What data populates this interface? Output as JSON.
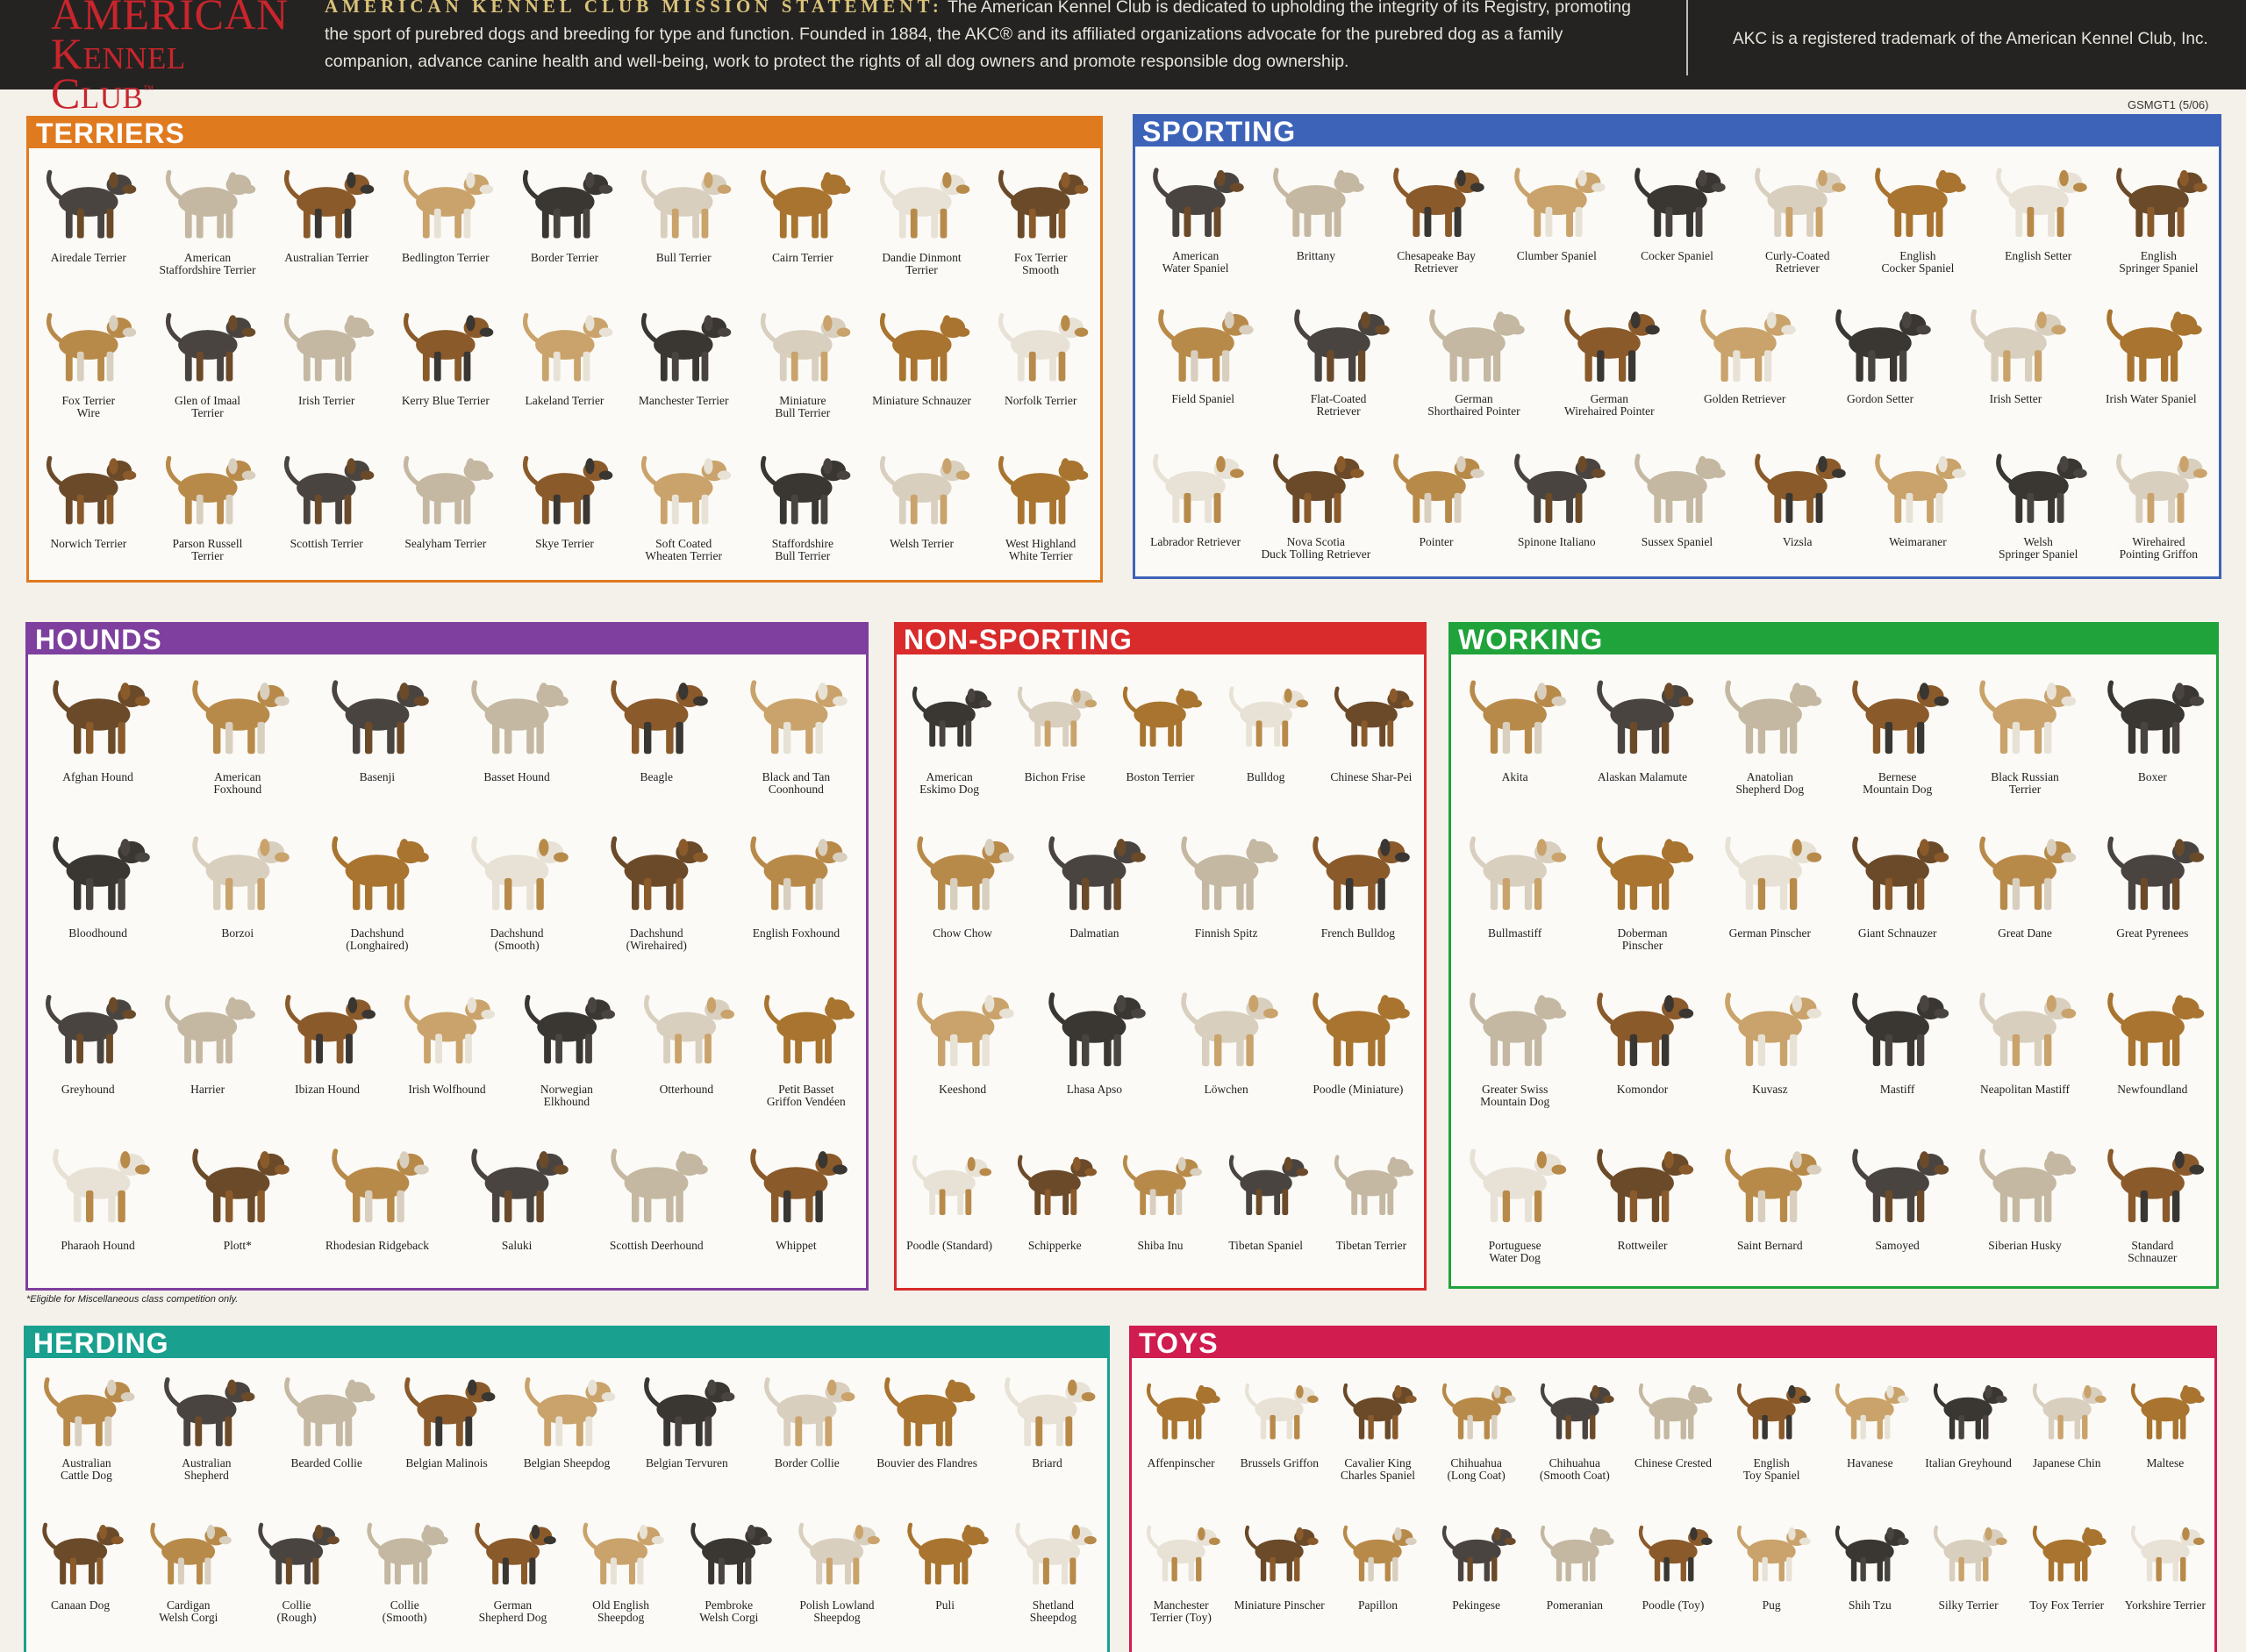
{
  "header": {
    "logo_line1": "American",
    "logo_line2": "Kennel Club",
    "logo_mark": "™",
    "mission_heading": "American Kennel Club Mission Statement:",
    "mission_text": "The American Kennel Club is dedicated to upholding the integrity of its Registry, promoting the sport of purebred dogs and breeding for type and function. Founded in 1884, the AKC® and its affiliated organizations advocate for the purebred dog as a family companion, advance canine health and well-being, work to protect the rights of all dog owners and promote responsible dog ownership.",
    "trademark_note": "AKC is a registered trademark of the American Kennel Club, Inc.",
    "code": "GSMGT1 (5/06)"
  },
  "colors": {
    "terriers": "#e07a1f",
    "sporting": "#3d63b8",
    "hounds": "#7e3f9e",
    "non_sporting": "#d92b2b",
    "working": "#1fa33a",
    "herding": "#1aa08e",
    "toys": "#d01c4f"
  },
  "groups": {
    "terriers": {
      "title": "TERRIERS",
      "breeds": [
        "Airedale Terrier",
        "American\nStaffordshire Terrier",
        "Australian Terrier",
        "Bedlington Terrier",
        "Border Terrier",
        "Bull Terrier",
        "Cairn Terrier",
        "Dandie Dinmont\nTerrier",
        "Fox Terrier\nSmooth",
        "Fox Terrier\nWire",
        "Glen of Imaal\nTerrier",
        "Irish Terrier",
        "Kerry Blue Terrier",
        "Lakeland Terrier",
        "Manchester Terrier",
        "Miniature\nBull Terrier",
        "Miniature Schnauzer",
        "Norfolk Terrier",
        "Norwich Terrier",
        "Parson Russell\nTerrier",
        "Scottish Terrier",
        "Sealyham Terrier",
        "Skye Terrier",
        "Soft Coated\nWheaten Terrier",
        "Staffordshire\nBull Terrier",
        "Welsh Terrier",
        "West Highland\nWhite Terrier"
      ]
    },
    "sporting": {
      "title": "SPORTING",
      "breeds": [
        "American\nWater Spaniel",
        "Brittany",
        "Chesapeake Bay\nRetriever",
        "Clumber Spaniel",
        "Cocker Spaniel",
        "Curly-Coated\nRetriever",
        "English\nCocker Spaniel",
        "English Setter",
        "English\nSpringer Spaniel",
        "Field Spaniel",
        "Flat-Coated\nRetriever",
        "German\nShorthaired Pointer",
        "German\nWirehaired Pointer",
        "Golden Retriever",
        "Gordon Setter",
        "Irish Setter",
        "Irish Water Spaniel",
        "Labrador Retriever",
        "Nova Scotia\nDuck Tolling Retriever",
        "Pointer",
        "Spinone Italiano",
        "Sussex Spaniel",
        "Vizsla",
        "Weimaraner",
        "Welsh\nSpringer Spaniel",
        "Wirehaired\nPointing Griffon"
      ]
    },
    "hounds": {
      "title": "HOUNDS",
      "breeds": [
        "Afghan Hound",
        "American\nFoxhound",
        "Basenji",
        "Basset Hound",
        "Beagle",
        "Black and Tan\nCoonhound",
        "Bloodhound",
        "Borzoi",
        "Dachshund\n(Longhaired)",
        "Dachshund\n(Smooth)",
        "Dachshund\n(Wirehaired)",
        "English Foxhound",
        "Greyhound",
        "Harrier",
        "Ibizan Hound",
        "Irish Wolfhound",
        "Norwegian\nElkhound",
        "Otterhound",
        "Petit Basset\nGriffon Vendéen",
        "Pharaoh Hound",
        "Plott*",
        "Rhodesian Ridgeback",
        "Saluki",
        "Scottish Deerhound",
        "Whippet"
      ],
      "footnote": "*Eligible for Miscellaneous class competition only."
    },
    "non_sporting": {
      "title": "NON-SPORTING",
      "breeds": [
        "American\nEskimo Dog",
        "Bichon Frise",
        "Boston Terrier",
        "Bulldog",
        "Chinese Shar-Pei",
        "Chow Chow",
        "Dalmatian",
        "Finnish Spitz",
        "French Bulldog",
        "Keeshond",
        "Lhasa Apso",
        "Löwchen",
        "Poodle (Miniature)",
        "Poodle (Standard)",
        "Schipperke",
        "Shiba Inu",
        "Tibetan Spaniel",
        "Tibetan Terrier"
      ]
    },
    "working": {
      "title": "WORKING",
      "breeds": [
        "Akita",
        "Alaskan Malamute",
        "Anatolian\nShepherd Dog",
        "Bernese\nMountain Dog",
        "Black Russian\nTerrier",
        "Boxer",
        "Bullmastiff",
        "Doberman\nPinscher",
        "German Pinscher",
        "Giant Schnauzer",
        "Great Dane",
        "Great Pyrenees",
        "Greater Swiss\nMountain Dog",
        "Komondor",
        "Kuvasz",
        "Mastiff",
        "Neapolitan Mastiff",
        "Newfoundland",
        "Portuguese\nWater Dog",
        "Rottweiler",
        "Saint Bernard",
        "Samoyed",
        "Siberian Husky",
        "Standard\nSchnauzer"
      ]
    },
    "herding": {
      "title": "HERDING",
      "breeds": [
        "Australian\nCattle Dog",
        "Australian\nShepherd",
        "Bearded Collie",
        "Belgian Malinois",
        "Belgian Sheepdog",
        "Belgian Tervuren",
        "Border Collie",
        "Bouvier des Flandres",
        "Briard",
        "Canaan Dog",
        "Cardigan\nWelsh Corgi",
        "Collie\n(Rough)",
        "Collie\n(Smooth)",
        "German\nShepherd Dog",
        "Old English\nSheepdog",
        "Pembroke\nWelsh Corgi",
        "Polish Lowland\nSheepdog",
        "Puli",
        "Shetland\nSheepdog"
      ]
    },
    "toys": {
      "title": "TOYS",
      "breeds": [
        "Affenpinscher",
        "Brussels Griffon",
        "Cavalier King\nCharles Spaniel",
        "Chihuahua\n(Long Coat)",
        "Chihuahua\n(Smooth Coat)",
        "Chinese Crested",
        "English\nToy Spaniel",
        "Havanese",
        "Italian Greyhound",
        "Japanese Chin",
        "Maltese",
        "Manchester\nTerrier (Toy)",
        "Miniature Pinscher",
        "Papillon",
        "Pekingese",
        "Pomeranian",
        "Poodle (Toy)",
        "Pug",
        "Shih Tzu",
        "Silky Terrier",
        "Toy Fox Terrier",
        "Yorkshire Terrier"
      ]
    }
  }
}
